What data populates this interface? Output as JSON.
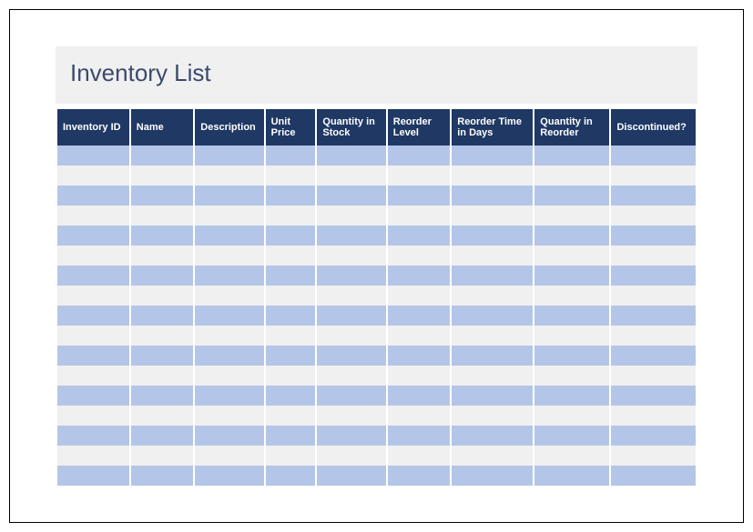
{
  "title": "Inventory List",
  "columns": [
    "Inventory ID",
    "Name",
    "Description",
    "Unit Price",
    "Quantity in Stock",
    "Reorder Level",
    "Reorder Time in Days",
    "Quantity in Reorder",
    "Discontinued?"
  ],
  "rows": [
    [
      "",
      "",
      "",
      "",
      "",
      "",
      "",
      "",
      ""
    ],
    [
      "",
      "",
      "",
      "",
      "",
      "",
      "",
      "",
      ""
    ],
    [
      "",
      "",
      "",
      "",
      "",
      "",
      "",
      "",
      ""
    ],
    [
      "",
      "",
      "",
      "",
      "",
      "",
      "",
      "",
      ""
    ],
    [
      "",
      "",
      "",
      "",
      "",
      "",
      "",
      "",
      ""
    ],
    [
      "",
      "",
      "",
      "",
      "",
      "",
      "",
      "",
      ""
    ],
    [
      "",
      "",
      "",
      "",
      "",
      "",
      "",
      "",
      ""
    ],
    [
      "",
      "",
      "",
      "",
      "",
      "",
      "",
      "",
      ""
    ],
    [
      "",
      "",
      "",
      "",
      "",
      "",
      "",
      "",
      ""
    ],
    [
      "",
      "",
      "",
      "",
      "",
      "",
      "",
      "",
      ""
    ],
    [
      "",
      "",
      "",
      "",
      "",
      "",
      "",
      "",
      ""
    ],
    [
      "",
      "",
      "",
      "",
      "",
      "",
      "",
      "",
      ""
    ],
    [
      "",
      "",
      "",
      "",
      "",
      "",
      "",
      "",
      ""
    ],
    [
      "",
      "",
      "",
      "",
      "",
      "",
      "",
      "",
      ""
    ],
    [
      "",
      "",
      "",
      "",
      "",
      "",
      "",
      "",
      ""
    ],
    [
      "",
      "",
      "",
      "",
      "",
      "",
      "",
      "",
      ""
    ],
    [
      "",
      "",
      "",
      "",
      "",
      "",
      "",
      "",
      ""
    ]
  ]
}
